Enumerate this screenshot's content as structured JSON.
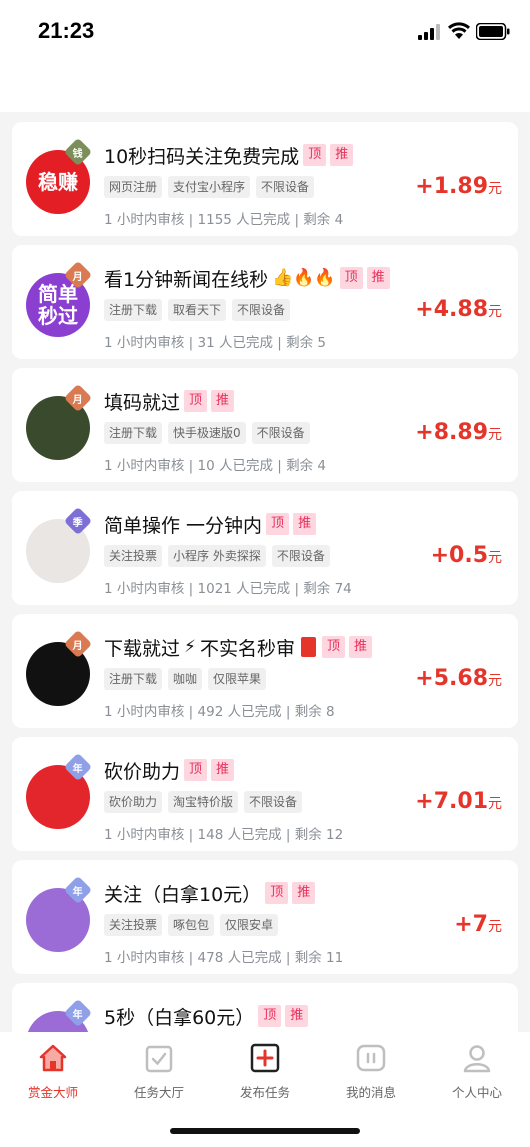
{
  "status_bar": {
    "time": "21:23"
  },
  "colors": {
    "accent": "#e5352b",
    "pill_text": "#e8315c",
    "pill_bg": "#fdd6e0"
  },
  "tasks": [
    {
      "title": "10秒扫码关注免费完成",
      "emoji": "",
      "badges": [
        "顶",
        "推"
      ],
      "tags": [
        "网页注册",
        "支付宝小程序",
        "不限设备"
      ],
      "meta": "1 小时内审核 | 1155 人已完成 | 剩余 4",
      "price": "+1.89",
      "unit": "元",
      "avatar": {
        "text": "稳赚",
        "bg": "#e31e24",
        "badge": "钱",
        "badge_color": "#7c8f5a"
      }
    },
    {
      "title": "看1分钟新闻在线秒",
      "emoji": "👍🔥🔥",
      "badges": [
        "顶",
        "推"
      ],
      "tags": [
        "注册下载",
        "取看天下",
        "不限设备"
      ],
      "meta": "1 小时内审核 | 31 人已完成 | 剩余 5",
      "price": "+4.88",
      "unit": "元",
      "avatar": {
        "text": "简单\n秒过",
        "bg": "#8a3fd1",
        "badge": "月",
        "badge_color": "#d97a52"
      }
    },
    {
      "title": "填码就过",
      "emoji": "",
      "badges": [
        "顶",
        "推"
      ],
      "tags": [
        "注册下载",
        "快手极速版0",
        "不限设备"
      ],
      "meta": "1 小时内审核 | 10 人已完成 | 剩余 4",
      "price": "+8.89",
      "unit": "元",
      "avatar": {
        "text": "",
        "bg": "#3a4a2c",
        "badge": "月",
        "badge_color": "#d97a52"
      }
    },
    {
      "title": "简单操作 一分钟内",
      "emoji": "",
      "badges": [
        "顶",
        "推"
      ],
      "tags": [
        "关注投票",
        "小程序 外卖探探",
        "不限设备"
      ],
      "meta": "1 小时内审核 | 1021 人已完成 | 剩余 74",
      "price": "+0.5",
      "unit": "元",
      "avatar": {
        "text": "",
        "bg": "#e9e6e3",
        "badge": "季",
        "badge_color": "#7d6fd6"
      }
    },
    {
      "title": "下载就过",
      "emoji": "⚡",
      "title_after": "不实名秒审",
      "badges": [
        "顶",
        "推"
      ],
      "tags": [
        "注册下载",
        "咖咖",
        "仅限苹果"
      ],
      "meta": "1 小时内审核 | 492 人已完成 | 剩余 8",
      "price": "+5.68",
      "unit": "元",
      "avatar": {
        "text": "",
        "bg": "#111111",
        "badge": "月",
        "badge_color": "#d97a52"
      }
    },
    {
      "title": "砍价助力",
      "emoji": "",
      "badges": [
        "顶",
        "推"
      ],
      "tags": [
        "砍价助力",
        "淘宝特价版",
        "不限设备"
      ],
      "meta": "1 小时内审核 | 148 人已完成 | 剩余 12",
      "price": "+7.01",
      "unit": "元",
      "avatar": {
        "text": "",
        "bg": "#e3262b",
        "badge": "年",
        "badge_color": "#8fa0e8"
      }
    },
    {
      "title": "关注（白拿10元）",
      "emoji": "",
      "badges": [
        "顶",
        "推"
      ],
      "tags": [
        "关注投票",
        "啄包包",
        "仅限安卓"
      ],
      "meta": "1 小时内审核 | 478 人已完成 | 剩余 11",
      "price": "+7",
      "unit": "元",
      "avatar": {
        "text": "",
        "bg": "#9b6bd6",
        "badge": "年",
        "badge_color": "#8fa0e8"
      }
    },
    {
      "title": "5秒（白拿60元）",
      "emoji": "",
      "badges": [
        "顶",
        "推"
      ],
      "tags": [],
      "meta": "",
      "price": "",
      "unit": "",
      "avatar": {
        "text": "",
        "bg": "#9b6bd6",
        "badge": "年",
        "badge_color": "#8fa0e8"
      }
    }
  ],
  "tab_bar": {
    "tabs": [
      {
        "label": "赏金大师",
        "icon": "home-icon",
        "active": true
      },
      {
        "label": "任务大厅",
        "icon": "task-hall-icon",
        "active": false
      },
      {
        "label": "发布任务",
        "icon": "publish-icon",
        "active": false
      },
      {
        "label": "我的消息",
        "icon": "message-icon",
        "active": false
      },
      {
        "label": "个人中心",
        "icon": "profile-icon",
        "active": false
      }
    ]
  }
}
